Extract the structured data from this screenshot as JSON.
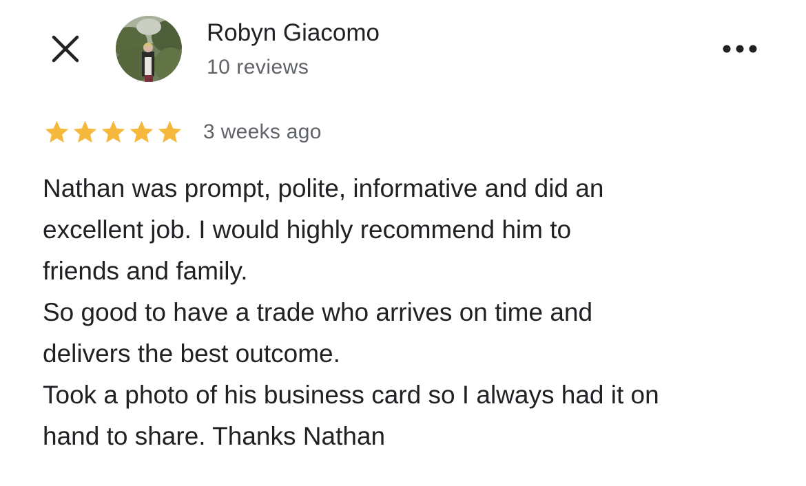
{
  "header": {
    "close_icon": "close-icon",
    "more_icon": "more-horizontal-icon",
    "author_name": "Robyn Giacomo",
    "review_count": "10 reviews"
  },
  "rating": {
    "stars": 5,
    "max_stars": 5,
    "star_color": "#F6B83C",
    "date": "3 weeks ago"
  },
  "review": {
    "lines": [
      "Nathan was prompt, polite, informative and did an",
      "excellent job. I would highly recommend him to",
      "friends and family.",
      "So good to have a trade who arrives on time and",
      "delivers the best outcome.",
      "Took a photo of his business card so I always had it on",
      "hand to share. Thanks Nathan"
    ]
  },
  "colors": {
    "primary_text": "#202124",
    "secondary_text": "#5F6368",
    "background": "#FFFFFF"
  }
}
